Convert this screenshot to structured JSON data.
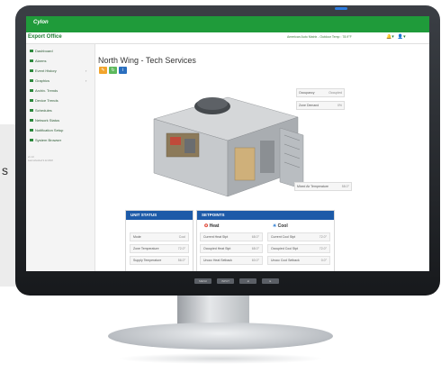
{
  "side_glyph": "s",
  "bezel_buttons": [
    "MENU",
    "INPUT",
    "◄",
    "►"
  ],
  "app": {
    "logo": "Cylon",
    "site_name": "Export Office",
    "status_text": "American Auto Matrix - Outdoor Temp : 78.9°F",
    "nav": [
      {
        "label": "Dashboard",
        "arrow": ""
      },
      {
        "label": "Alarms",
        "arrow": ""
      },
      {
        "label": "Event History",
        "arrow": "›"
      },
      {
        "label": "Graphics",
        "arrow": "›"
      },
      {
        "label": "Archiv. Trends",
        "arrow": ""
      },
      {
        "label": "Device Trends",
        "arrow": ""
      },
      {
        "label": "Schedules",
        "arrow": ""
      },
      {
        "label": "Network Status",
        "arrow": ""
      },
      {
        "label": "Notification Setup",
        "arrow": ""
      },
      {
        "label": "System Browser",
        "arrow": ""
      }
    ],
    "version_lines": [
      "v1.1.0",
      "Last refreshed 9.12.2018"
    ],
    "page_title": "North Wing - Tech Services",
    "unit_labels": [
      {
        "label": "Occupancy",
        "value": "Occupied"
      },
      {
        "label": "Zone Demand",
        "value": "0%"
      },
      {
        "label": "Mixed Air Temperature",
        "value": "58.0°"
      }
    ],
    "unit_status": {
      "title": "UNIT STATUS",
      "rows": [
        {
          "label": "Mode",
          "value": "Cool"
        },
        {
          "label": "Zone Temperature",
          "value": "72.0°"
        },
        {
          "label": "Supply Temperature",
          "value": "56.0°"
        }
      ]
    },
    "setpoints": {
      "title": "SETPOINTS",
      "heat_label": "Heat",
      "cool_label": "Cool",
      "heat_rows": [
        {
          "label": "Current Heat Stpt",
          "value": "68.0°"
        },
        {
          "label": "Occupied Heat Stpt",
          "value": "68.0°"
        },
        {
          "label": "Unocc Heat Setback",
          "value": "60.0°"
        }
      ],
      "cool_rows": [
        {
          "label": "Current Cool Stpt",
          "value": "72.0°"
        },
        {
          "label": "Occupied Cool Stpt",
          "value": "72.0°"
        },
        {
          "label": "Unocc Cool Setback",
          "value": "0.0°"
        }
      ]
    }
  }
}
